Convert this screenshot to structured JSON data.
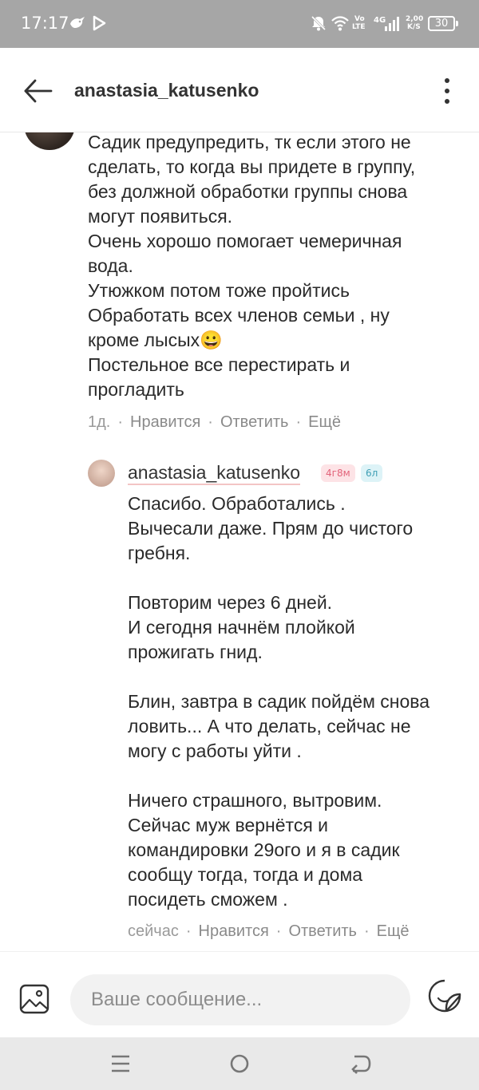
{
  "status_bar": {
    "time": "17:17",
    "volte": "Vo",
    "lte": "LTE",
    "network": "4G",
    "speed_value": "2,00",
    "speed_unit": "K/S",
    "battery": "30",
    "icons": [
      "bird-icon",
      "play-icon",
      "mute-icon",
      "wifi-icon",
      "signal-icon",
      "battery-icon"
    ]
  },
  "header": {
    "title": "anastasia_katusenko",
    "back_icon": "arrow-left-icon",
    "menu_icon": "more-vertical-icon"
  },
  "comments": [
    {
      "text": "Садик предупредить, тк если этого не\nсделать, то когда вы придете в группу,\nбез должной обработки группы снова\nмогут появиться.\nОчень хорошо помогает чемеричная\nвода.\nУтюжком потом тоже пройтись\nОбработать всех членов семьи , ну\nкроме лысых😀\nПостельное все перестирать и\nпрогладить",
      "time": "1д.",
      "like": "Нравится",
      "reply": "Ответить",
      "more": "Ещё"
    },
    {
      "author": "anastasia_katusenko",
      "badge_age": "4г8м",
      "badge_age2": "6л",
      "text": "Спасибо. Обработались .\nВычесали даже. Прям до чистого\nгребня.\n\nПовторим через 6 дней.\nИ сегодня начнём плойкой\nпрожигать гнид.\n\nБлин, завтра в садик пойдём снова\nловить... А что делать, сейчас не\nмогу с работы уйти .\n\nНичего страшного, вытровим.\nСейчас муж вернётся и\nкомандировки 29ого и я в садик\nсообщу тогда, тогда и дома\nпосидеть сможем .",
      "time": "сейчас",
      "like": "Нравится",
      "reply": "Ответить",
      "more": "Ещё"
    }
  ],
  "composer": {
    "placeholder": "Ваше сообщение...",
    "image_icon": "image-icon",
    "sticker_icon": "sticker-icon"
  },
  "nav_bar": {
    "icons": [
      "menu-icon",
      "home-circle-icon",
      "back-icon"
    ]
  }
}
